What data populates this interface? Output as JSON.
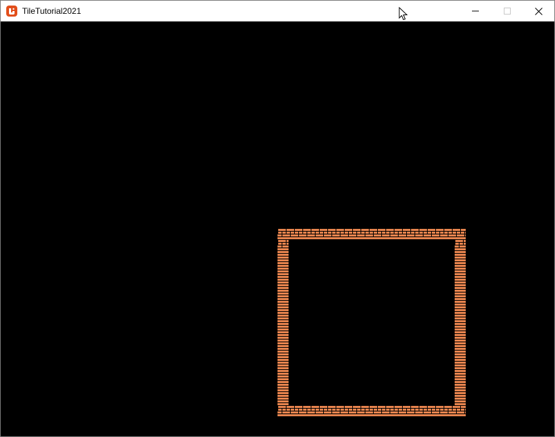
{
  "window": {
    "title": "TileTutorial2021",
    "app_icon": "monogame-logo-icon",
    "controls": {
      "minimize_icon": "minimize-icon",
      "maximize_icon": "maximize-icon",
      "close_icon": "close-icon"
    }
  },
  "game": {
    "background_color": "#000000",
    "brick_color": "#e8844e",
    "mortar_color": "#000000",
    "room": {
      "tile_size": 16,
      "columns": 17,
      "rows": 17,
      "wall_tile": "brick"
    }
  },
  "colors": {
    "icon_accent": "#e24e1b"
  }
}
